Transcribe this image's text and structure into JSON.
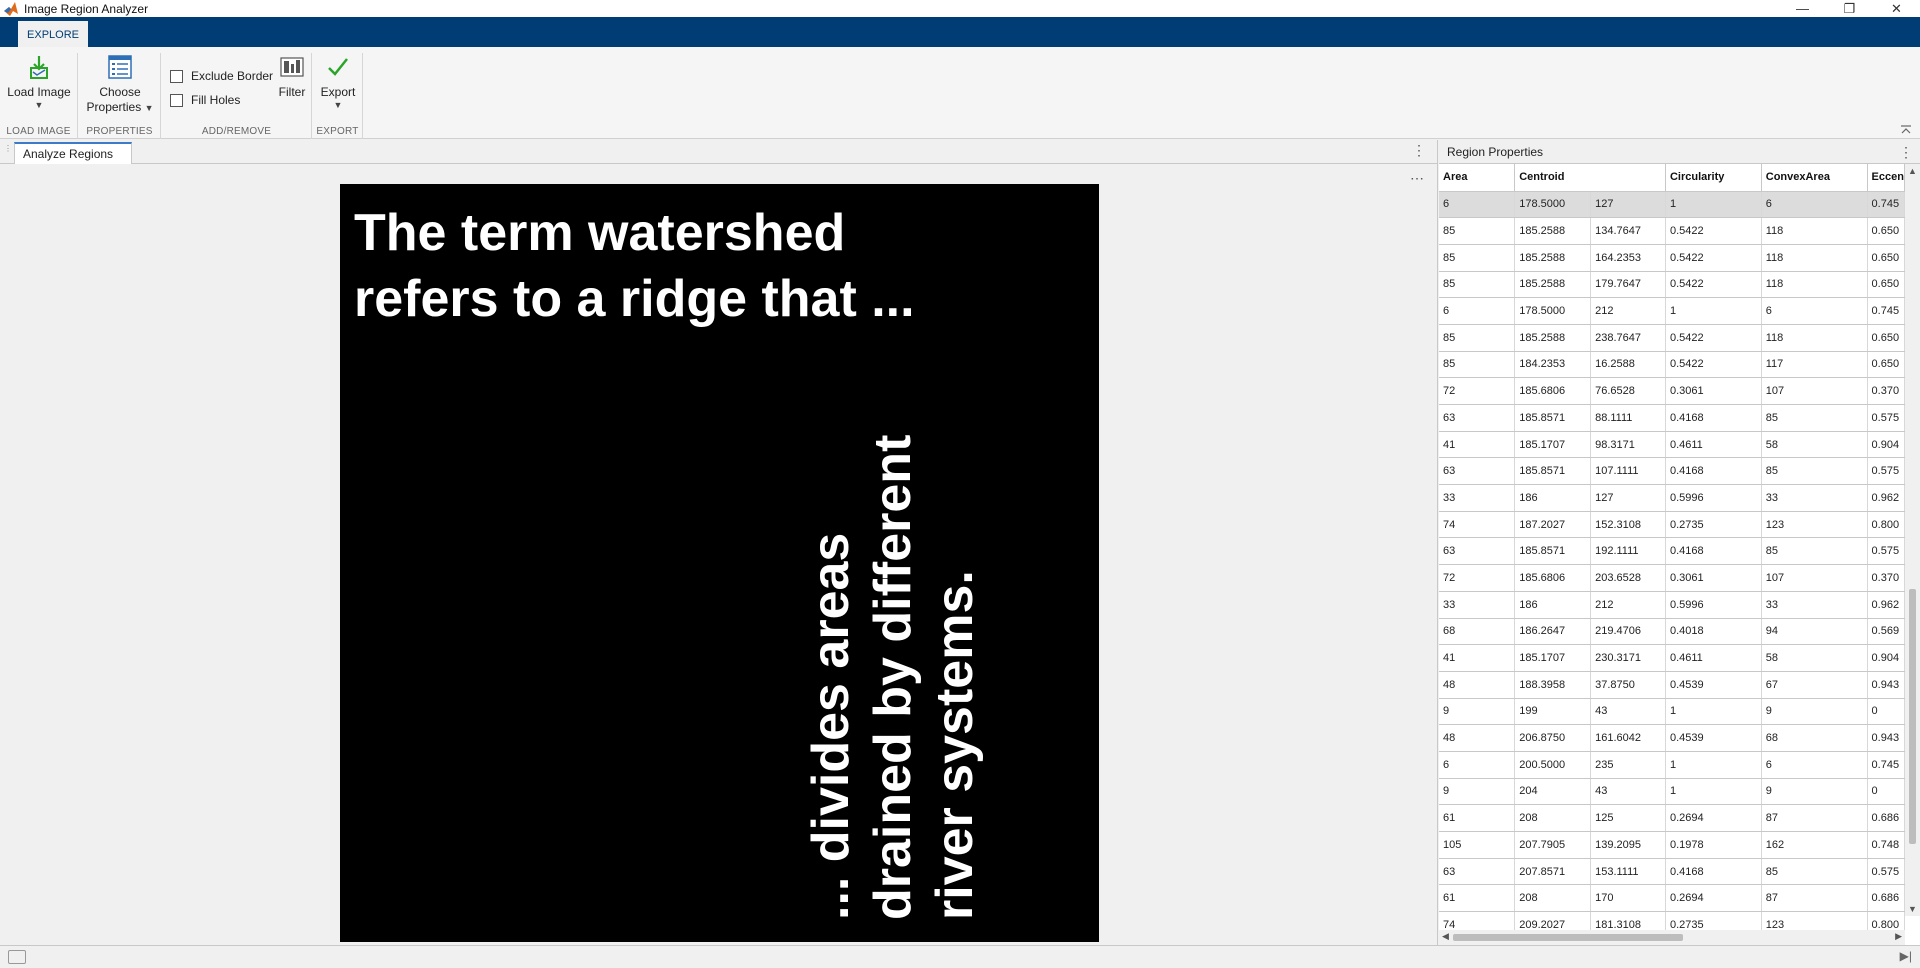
{
  "window": {
    "title": "Image Region Analyzer",
    "minimize": "—",
    "maximize": "❐",
    "close": "✕"
  },
  "ribbon_tab": "EXPLORE",
  "toolstrip": {
    "load_image": {
      "label": "Load Image",
      "caret": "▼",
      "section": "LOAD IMAGE"
    },
    "choose_properties": {
      "label_line1": "Choose",
      "label_line2": "Properties",
      "caret": "▼",
      "section": "PROPERTIES"
    },
    "exclude_border": "Exclude Border",
    "fill_holes": "Fill Holes",
    "filter": "Filter",
    "addremove_section": "ADD/REMOVE",
    "export": {
      "label": "Export",
      "caret": "▼",
      "section": "EXPORT"
    }
  },
  "left_panel": {
    "tab": "Analyze Regions",
    "image_text": {
      "line1": "The term watershed",
      "line2": "refers to a ridge that ...",
      "vline1": "... divides areas",
      "vline2": "drained by different",
      "vline3": "river systems."
    }
  },
  "right_panel": {
    "title": "Region Properties",
    "columns": [
      "Area",
      "Centroid",
      "",
      "Circularity",
      "ConvexArea",
      "Eccen"
    ],
    "rows": [
      [
        "6",
        "178.5000",
        "127",
        "1",
        "6",
        "0.745"
      ],
      [
        "85",
        "185.2588",
        "134.7647",
        "0.5422",
        "118",
        "0.650"
      ],
      [
        "85",
        "185.2588",
        "164.2353",
        "0.5422",
        "118",
        "0.650"
      ],
      [
        "85",
        "185.2588",
        "179.7647",
        "0.5422",
        "118",
        "0.650"
      ],
      [
        "6",
        "178.5000",
        "212",
        "1",
        "6",
        "0.745"
      ],
      [
        "85",
        "185.2588",
        "238.7647",
        "0.5422",
        "118",
        "0.650"
      ],
      [
        "85",
        "184.2353",
        "16.2588",
        "0.5422",
        "117",
        "0.650"
      ],
      [
        "72",
        "185.6806",
        "76.6528",
        "0.3061",
        "107",
        "0.370"
      ],
      [
        "63",
        "185.8571",
        "88.1111",
        "0.4168",
        "85",
        "0.575"
      ],
      [
        "41",
        "185.1707",
        "98.3171",
        "0.4611",
        "58",
        "0.904"
      ],
      [
        "63",
        "185.8571",
        "107.1111",
        "0.4168",
        "85",
        "0.575"
      ],
      [
        "33",
        "186",
        "127",
        "0.5996",
        "33",
        "0.962"
      ],
      [
        "74",
        "187.2027",
        "152.3108",
        "0.2735",
        "123",
        "0.800"
      ],
      [
        "63",
        "185.8571",
        "192.1111",
        "0.4168",
        "85",
        "0.575"
      ],
      [
        "72",
        "185.6806",
        "203.6528",
        "0.3061",
        "107",
        "0.370"
      ],
      [
        "33",
        "186",
        "212",
        "0.5996",
        "33",
        "0.962"
      ],
      [
        "68",
        "186.2647",
        "219.4706",
        "0.4018",
        "94",
        "0.569"
      ],
      [
        "41",
        "185.1707",
        "230.3171",
        "0.4611",
        "58",
        "0.904"
      ],
      [
        "48",
        "188.3958",
        "37.8750",
        "0.4539",
        "67",
        "0.943"
      ],
      [
        "9",
        "199",
        "43",
        "1",
        "9",
        "0"
      ],
      [
        "48",
        "206.8750",
        "161.6042",
        "0.4539",
        "68",
        "0.943"
      ],
      [
        "6",
        "200.5000",
        "235",
        "1",
        "6",
        "0.745"
      ],
      [
        "9",
        "204",
        "43",
        "1",
        "9",
        "0"
      ],
      [
        "61",
        "208",
        "125",
        "0.2694",
        "87",
        "0.686"
      ],
      [
        "105",
        "207.7905",
        "139.2095",
        "0.1978",
        "162",
        "0.748"
      ],
      [
        "63",
        "207.8571",
        "153.1111",
        "0.4168",
        "85",
        "0.575"
      ],
      [
        "61",
        "208",
        "170",
        "0.2694",
        "87",
        "0.686"
      ],
      [
        "74",
        "209.2027",
        "181.3108",
        "0.2735",
        "123",
        "0.800"
      ]
    ]
  },
  "colors": {
    "brand": "#003d74",
    "accent": "#3b7bc8",
    "check_green": "#2aa52a"
  }
}
